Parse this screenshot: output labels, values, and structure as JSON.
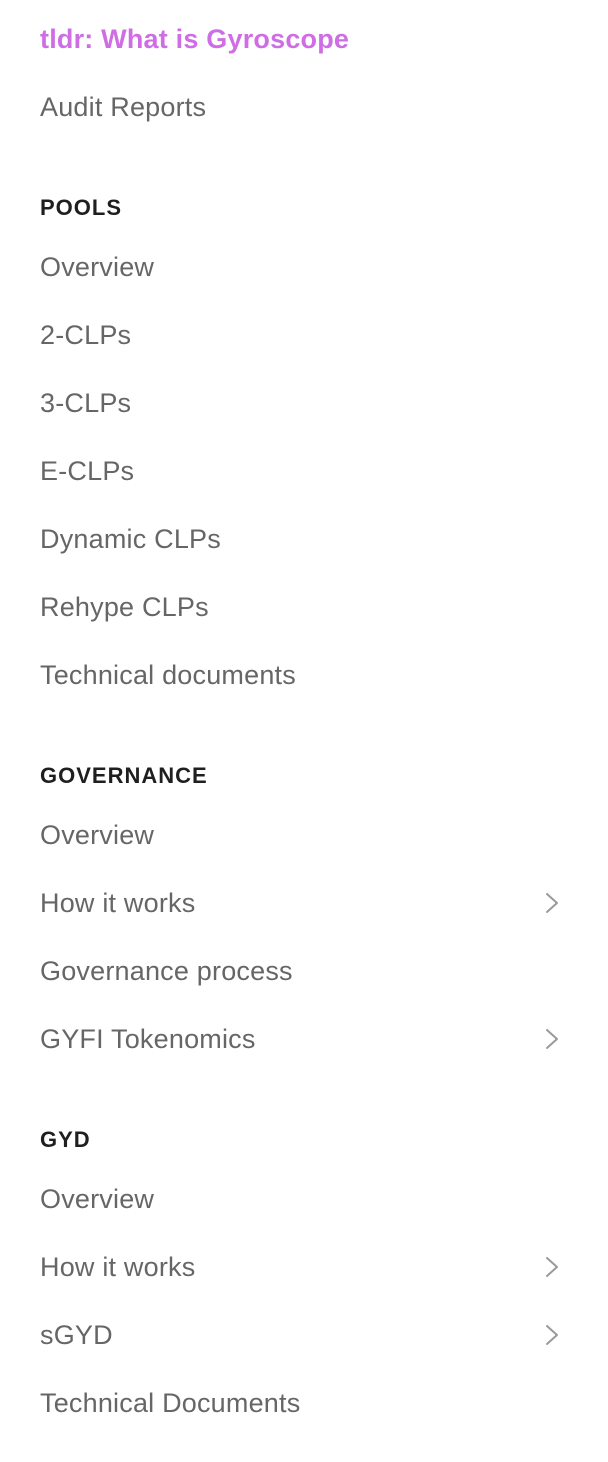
{
  "nav": {
    "top_items": [
      {
        "label": "tldr: What is Gyroscope"
      },
      {
        "label": "Audit Reports"
      }
    ],
    "sections": [
      {
        "heading": "POOLS",
        "items": [
          {
            "label": "Overview"
          },
          {
            "label": "2-CLPs"
          },
          {
            "label": "3-CLPs"
          },
          {
            "label": "E-CLPs"
          },
          {
            "label": "Dynamic CLPs"
          },
          {
            "label": "Rehype CLPs"
          },
          {
            "label": "Technical documents"
          }
        ]
      },
      {
        "heading": "GOVERNANCE",
        "items": [
          {
            "label": "Overview"
          },
          {
            "label": "How it works",
            "icon": "chevron-right-icon"
          },
          {
            "label": "Governance process"
          },
          {
            "label": "GYFI Tokenomics",
            "icon": "chevron-right-icon"
          }
        ]
      },
      {
        "heading": "GYD",
        "items": [
          {
            "label": "Overview"
          },
          {
            "label": "How it works",
            "icon": "chevron-right-icon"
          },
          {
            "label": "sGYD",
            "icon": "chevron-right-icon"
          },
          {
            "label": "Technical Documents"
          }
        ]
      }
    ],
    "colors": {
      "active": "#cf6ee4",
      "item_text": "#666666",
      "heading_text": "#1f1f1f",
      "chevron": "#9a9a9a"
    }
  }
}
